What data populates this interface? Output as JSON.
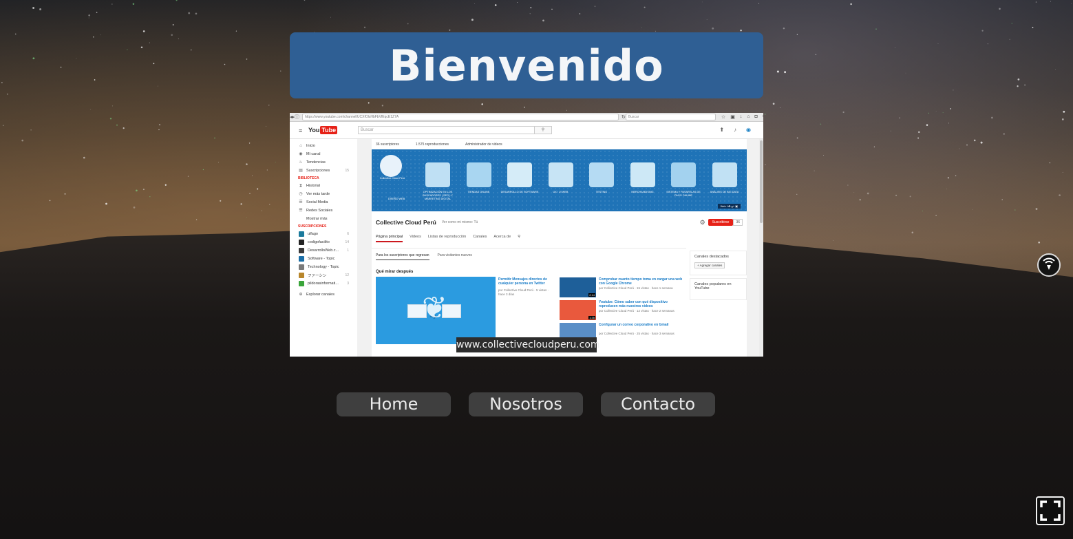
{
  "header": {
    "title": "Bienvenido"
  },
  "screenshot": {
    "browser": {
      "url": "https://www.youtube.com/channel/UCXfOlsHbFbVfEqcE1Z7A",
      "search_placeholder": "Buscar"
    },
    "youtube": {
      "logo_you": "You",
      "logo_tube": "Tube",
      "search_placeholder": "Buscar",
      "sidebar": {
        "items": [
          {
            "label": "Inicio",
            "icon": "home-icon"
          },
          {
            "label": "Mi canal",
            "icon": "user-icon"
          },
          {
            "label": "Tendencias",
            "icon": "flame-icon"
          },
          {
            "label": "Suscripciones",
            "icon": "subscriptions-icon",
            "count": "15"
          }
        ],
        "library_heading": "BIBLIOTECA",
        "library": [
          {
            "label": "Historial",
            "icon": "hourglass-icon"
          },
          {
            "label": "Ver más tarde",
            "icon": "clock-icon"
          },
          {
            "label": "Social Media",
            "icon": "list-icon"
          },
          {
            "label": "Redes Sociales",
            "icon": "list-icon"
          },
          {
            "label": "Mostrar más",
            "icon": ""
          }
        ],
        "subs_heading": "SUSCRIPCIONES",
        "subscriptions": [
          {
            "label": "ulfago",
            "count": "6",
            "color": "#1a7a9c"
          },
          {
            "label": "codigofacilito",
            "count": "14",
            "color": "#222222"
          },
          {
            "label": "DesarrolloWeb.c...",
            "count": "1",
            "color": "#3a3a3a"
          },
          {
            "label": "Software - Topic",
            "count": "",
            "color": "#1b6fa8"
          },
          {
            "label": "Technology - Topic",
            "count": "",
            "color": "#7a7a7a"
          },
          {
            "label": "ファーシン",
            "count": "12",
            "color": "#b8862b"
          },
          {
            "label": "pildorasinformati...",
            "count": "3",
            "color": "#3aa53a"
          }
        ],
        "explore": "Explorar canales"
      },
      "channel": {
        "stats": [
          "36 suscriptores",
          "1.575 reproducciones",
          "Administrador de videos"
        ],
        "banner_items": [
          {
            "label": "DISEÑO WEB"
          },
          {
            "label": "OPTIMIZACIÓN EN LOS BUSCADORES ( SEO ) Y MARKETING DIGITAL"
          },
          {
            "label": "TIENDAS ONLINE"
          },
          {
            "label": "DESARROLLO DE SOFTWARE"
          },
          {
            "label": "UX / UI WEB"
          },
          {
            "label": "TESTING"
          },
          {
            "label": "MERCHANDISING"
          },
          {
            "label": "SISTEMA Y PASARELAS DE PAGO ONLINE"
          },
          {
            "label": "ANÁLISIS DE BIG DATA"
          }
        ],
        "banner_logo": "Collective Cloud Perú",
        "banner_social": "Web",
        "name": "Collective Cloud Perú",
        "view_as": "Ver como mi mismo: Tú",
        "subscribe": "Suscribirse",
        "sub_count": "36",
        "tabs": [
          "Página principal",
          "Videos",
          "Listas de reproducción",
          "Canales",
          "Acerca de"
        ],
        "subtabs": [
          "Para los suscriptores que regresan",
          "Para visitantes nuevos"
        ],
        "section_title": "Qué mirar después",
        "main_video": {
          "title": "Permitir Mensajes directos de cualquier persona en Twitter",
          "meta": "por Collective Cloud Perú · 5 vistas · hace 3 días"
        },
        "videos": [
          {
            "title": "Comprobar cuanto tiempo toma en cargar una web con Google Chrome",
            "meta": "por Collective Cloud Perú · 15 vistas · hace 1 semana",
            "duration": "2:14",
            "color": "#1e5f99"
          },
          {
            "title": "Youtube: Cómo saber con qué dispositivo reproducen más nuestros videos",
            "meta": "por Collective Cloud Perú · 12 vistas · hace 2 semanas",
            "duration": "1:35",
            "color": "#e9593d"
          },
          {
            "title": "Configurar un correo corporativo en Gmail",
            "meta": "por Collective Cloud Perú · 25 vistas · hace 3 semanas",
            "duration": "",
            "color": "#5a8fc7"
          }
        ],
        "featured_channels": "Canales destacados",
        "add_channels": "+ Agregar canales",
        "popular_channels": "Canales populares en YouTube"
      }
    }
  },
  "caption": "www.collectivecloudperu.com",
  "nav": {
    "home": "Home",
    "about": "Nosotros",
    "contact": "Contacto"
  },
  "controls": {
    "side_toggle_icon": "signal-icon",
    "fullscreen_icon": "fullscreen-icon"
  }
}
